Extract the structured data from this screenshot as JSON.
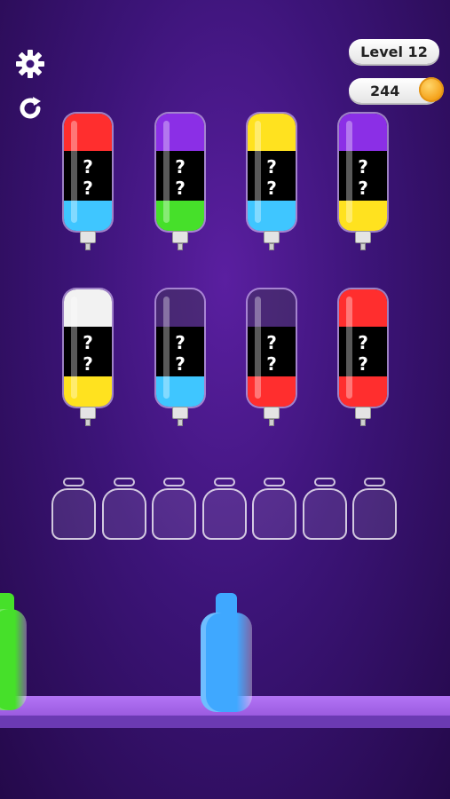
{
  "hud": {
    "level_label": "Level 12",
    "coins": "244"
  },
  "icons": {
    "settings": "gear-icon",
    "restart": "restart-icon",
    "coin": "coin-icon"
  },
  "hidden_marker": "?",
  "bottles": [
    {
      "top": "#ff2e2e",
      "bottom": "#3fc6ff"
    },
    {
      "top": "#8b2fe6",
      "bottom": "#46e02a"
    },
    {
      "top": "#ffe21f",
      "bottom": "#3fc6ff"
    },
    {
      "top": "#8b2fe6",
      "bottom": "#ffe21f"
    },
    {
      "top": "#f2f2f2",
      "bottom": "#ffe21f"
    },
    {
      "top": "empty",
      "bottom": "#3fc6ff"
    },
    {
      "top": "empty",
      "bottom": "#ff2e2e"
    },
    {
      "top": "#ff2e2e",
      "bottom": "#ff2e2e"
    }
  ],
  "empty_jars": 7,
  "filled_bottles": [
    {
      "color": "#46e02a"
    },
    {
      "color": "#3fa8ff"
    }
  ]
}
